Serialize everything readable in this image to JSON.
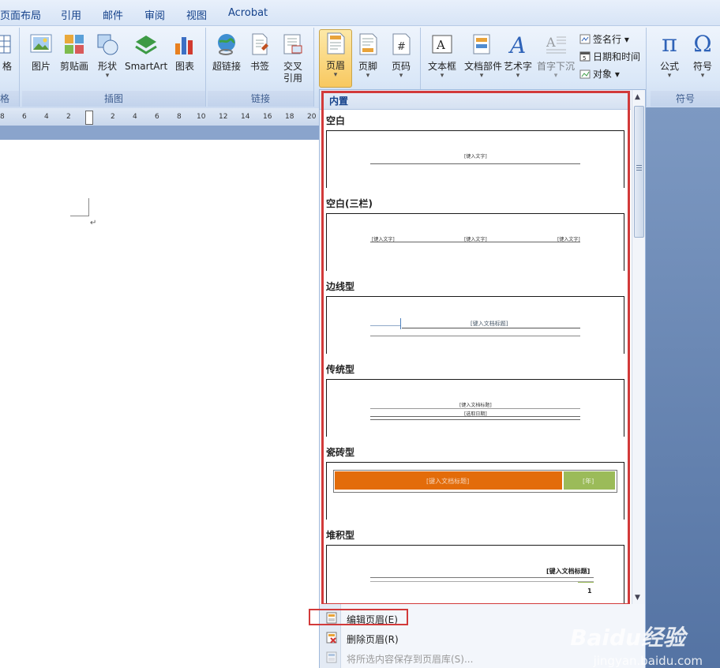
{
  "tabs": [
    "页面布局",
    "引用",
    "邮件",
    "审阅",
    "视图",
    "Acrobat"
  ],
  "ribbon": {
    "table_partial": "格",
    "illustration": {
      "label": "插图",
      "buttons": [
        {
          "label": "图片",
          "icon": "picture-icon"
        },
        {
          "label": "剪贴画",
          "icon": "clipart-icon"
        },
        {
          "label": "形状",
          "icon": "shapes-icon"
        },
        {
          "label": "SmartArt",
          "icon": "smartart-icon"
        },
        {
          "label": "图表",
          "icon": "chart-icon"
        }
      ]
    },
    "links": {
      "label": "链接",
      "buttons": [
        {
          "label": "超链接",
          "icon": "hyperlink-icon"
        },
        {
          "label": "书签",
          "icon": "bookmark-icon"
        },
        {
          "label": "交叉\n引用",
          "icon": "cross-reference-icon"
        }
      ]
    },
    "header_footer": {
      "buttons": [
        {
          "label": "页眉",
          "icon": "header-icon",
          "active": true
        },
        {
          "label": "页脚",
          "icon": "footer-icon"
        },
        {
          "label": "页码",
          "icon": "page-number-icon"
        }
      ]
    },
    "text": {
      "buttons": [
        {
          "label": "文本框",
          "icon": "textbox-icon"
        },
        {
          "label": "文档部件",
          "icon": "quick-parts-icon"
        },
        {
          "label": "艺术字",
          "icon": "wordart-icon"
        },
        {
          "label": "首字下沉",
          "icon": "dropcap-icon"
        }
      ],
      "small": [
        {
          "label": "签名行",
          "icon": "signature-line-icon"
        },
        {
          "label": "日期和时间",
          "icon": "date-time-icon"
        },
        {
          "label": "对象",
          "icon": "object-icon"
        }
      ]
    },
    "symbols": {
      "label": "符号",
      "buttons": [
        {
          "label": "公式",
          "icon": "pi-icon",
          "glyph": "π"
        },
        {
          "label": "符号",
          "icon": "omega-icon",
          "glyph": "Ω"
        }
      ]
    }
  },
  "ruler": [
    "8",
    "6",
    "4",
    "2",
    "2",
    "4",
    "6",
    "8",
    "10",
    "12",
    "14",
    "16",
    "18",
    "20"
  ],
  "gallery": {
    "header": "内置",
    "sections": [
      {
        "title": "空白",
        "placeholders": [
          "[键入文字]"
        ]
      },
      {
        "title": "空白(三栏)",
        "placeholders": [
          "[键入文字]",
          "[键入文字]",
          "[键入文字]"
        ]
      },
      {
        "title": "边线型",
        "placeholders": [
          "[键入文档标题]"
        ]
      },
      {
        "title": "传统型",
        "placeholders": [
          "[键入文档标题]",
          "[选取日期]"
        ]
      },
      {
        "title": "瓷砖型",
        "placeholders": [
          "[键入文档标题]",
          "[年]"
        ]
      },
      {
        "title": "堆积型",
        "placeholders": [
          "[键入文档标题]",
          "1"
        ]
      }
    ]
  },
  "menu": [
    {
      "label": "编辑页眉(E)",
      "icon": "edit-header-icon",
      "enabled": true
    },
    {
      "label": "删除页眉(R)",
      "icon": "delete-header-icon",
      "enabled": true
    },
    {
      "label": "将所选内容保存到页眉库(S)...",
      "icon": "save-selection-icon",
      "enabled": false
    }
  ],
  "watermark": {
    "brand": "Baidu经验",
    "url": "jingyan.baidu.com"
  },
  "colors": {
    "highlight": "#d23a3a",
    "tile_orange": "#e36c0a",
    "tile_green": "#9bbb59"
  }
}
